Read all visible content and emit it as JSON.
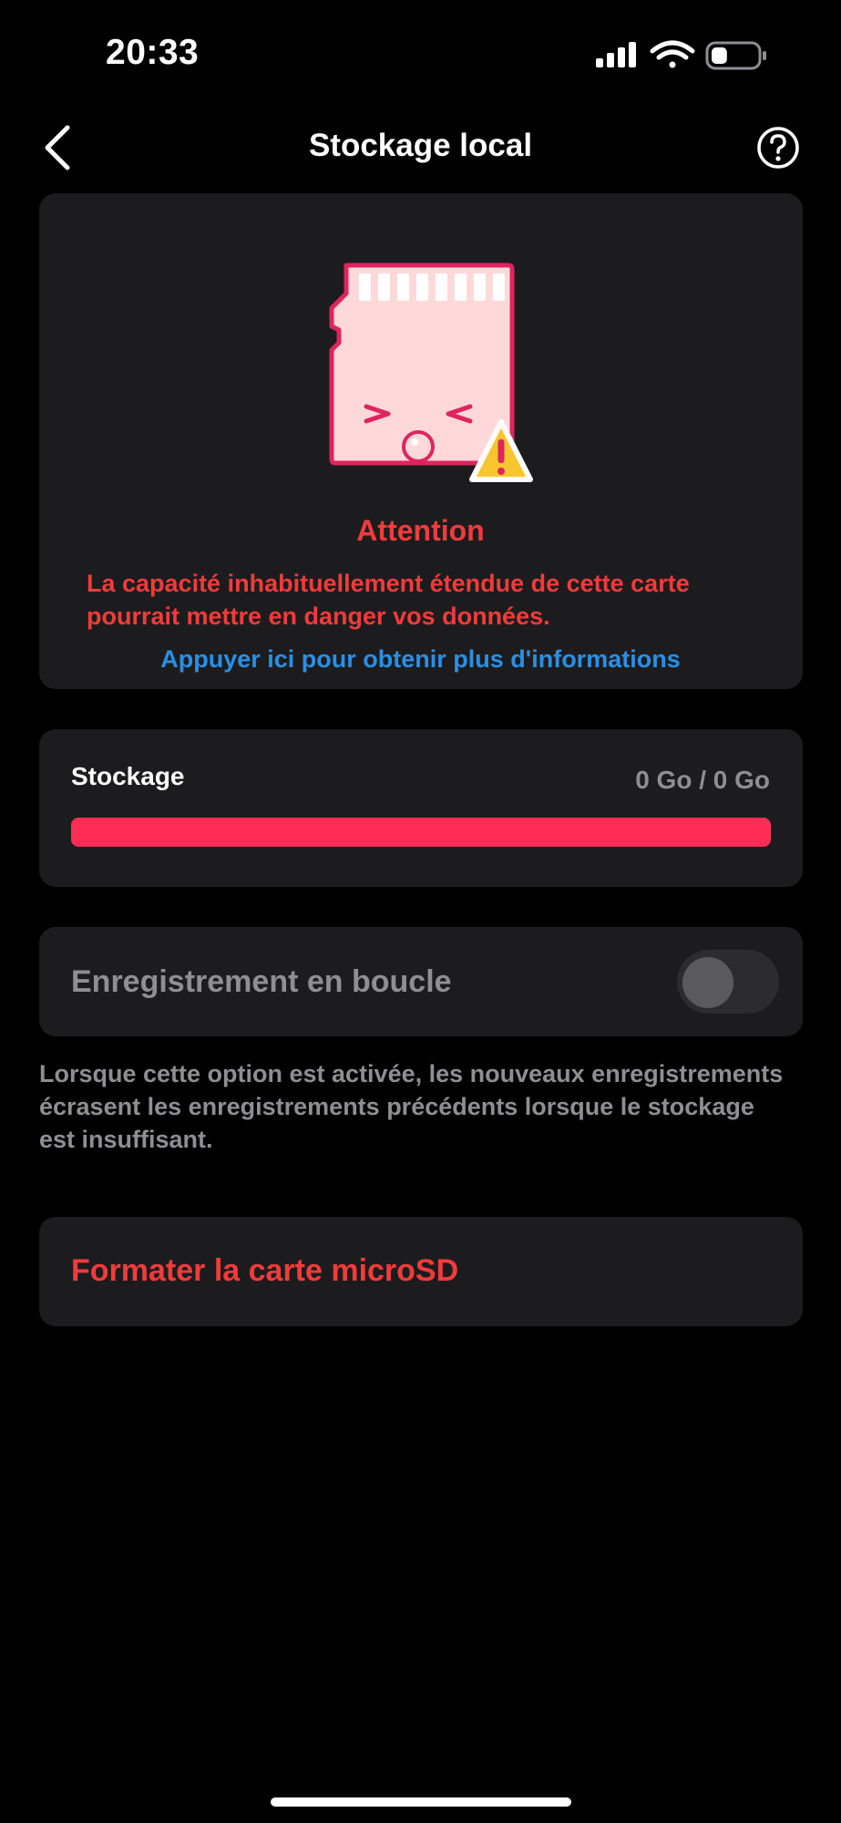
{
  "status_bar": {
    "time": "20:33",
    "icons": [
      "cellular-signal-icon",
      "wifi-icon",
      "battery-icon"
    ],
    "battery_level": 0.35
  },
  "nav": {
    "back_icon": "chevron-left-icon",
    "title": "Stockage local",
    "help_icon": "question-circle-icon"
  },
  "warning": {
    "illustration": "sd-card-warning-icon",
    "title": "Attention",
    "message": "La capacité inhabituellement étendue de cette carte pourrait mettre en danger vos données.",
    "link": "Appuyer ici pour obtenir plus d'informations"
  },
  "storage": {
    "label": "Stockage",
    "value": "0 Go / 0 Go",
    "fill_fraction": 1.0
  },
  "loop_recording": {
    "label": "Enregistrement en boucle",
    "enabled": false,
    "description": "Lorsque cette option est activée, les nouveaux enregistrements écrasent les enregistrements précédents lorsque le stockage est insuffisant."
  },
  "format": {
    "label": "Formater la carte microSD"
  },
  "colors": {
    "background": "#000000",
    "card": "#1c1c1e",
    "danger": "#f23b3b",
    "link": "#2a8fe6",
    "storage_bar": "#ff2d55",
    "muted_text": "#8e8e93"
  }
}
